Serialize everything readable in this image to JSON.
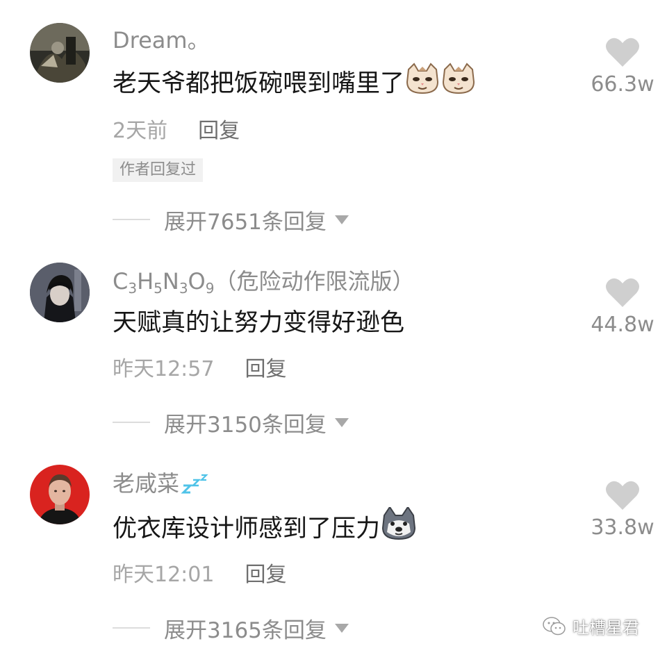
{
  "comments": [
    {
      "username": "Dream。",
      "text": "老天爷都把饭碗喂到嘴里了",
      "emojis": [
        "cat-emoji",
        "cat-emoji"
      ],
      "time": "2天前",
      "reply_label": "回复",
      "author_tag": "作者回复过",
      "expand_label": "展开7651条回复",
      "likes": "66.3w"
    },
    {
      "username_parts": {
        "c": "C",
        "s3a": "3",
        "h": "H",
        "s5": "5",
        "n": "N",
        "s3b": "3",
        "o": "O",
        "s9": "9",
        "suffix": "（危险动作限流版）"
      },
      "text": "天赋真的让努力变得好逊色",
      "time": "昨天12:57",
      "reply_label": "回复",
      "expand_label": "展开3150条回复",
      "likes": "44.8w"
    },
    {
      "username": "老咸菜",
      "username_badge": "zzz-icon",
      "text": "优衣库设计师感到了压力",
      "emojis": [
        "husky-emoji"
      ],
      "time": "昨天12:01",
      "reply_label": "回复",
      "expand_label": "展开3165条回复",
      "likes": "33.8w"
    }
  ],
  "watermark": {
    "icon": "wechat-icon",
    "text": "吐槽星君"
  },
  "colors": {
    "username": "#8c8c8c",
    "text": "#161616",
    "meta": "#a6a6a6",
    "heart": "#cfcfcf",
    "tag_bg": "#f1f1f1",
    "avatar3_bg": "#d9231f"
  }
}
